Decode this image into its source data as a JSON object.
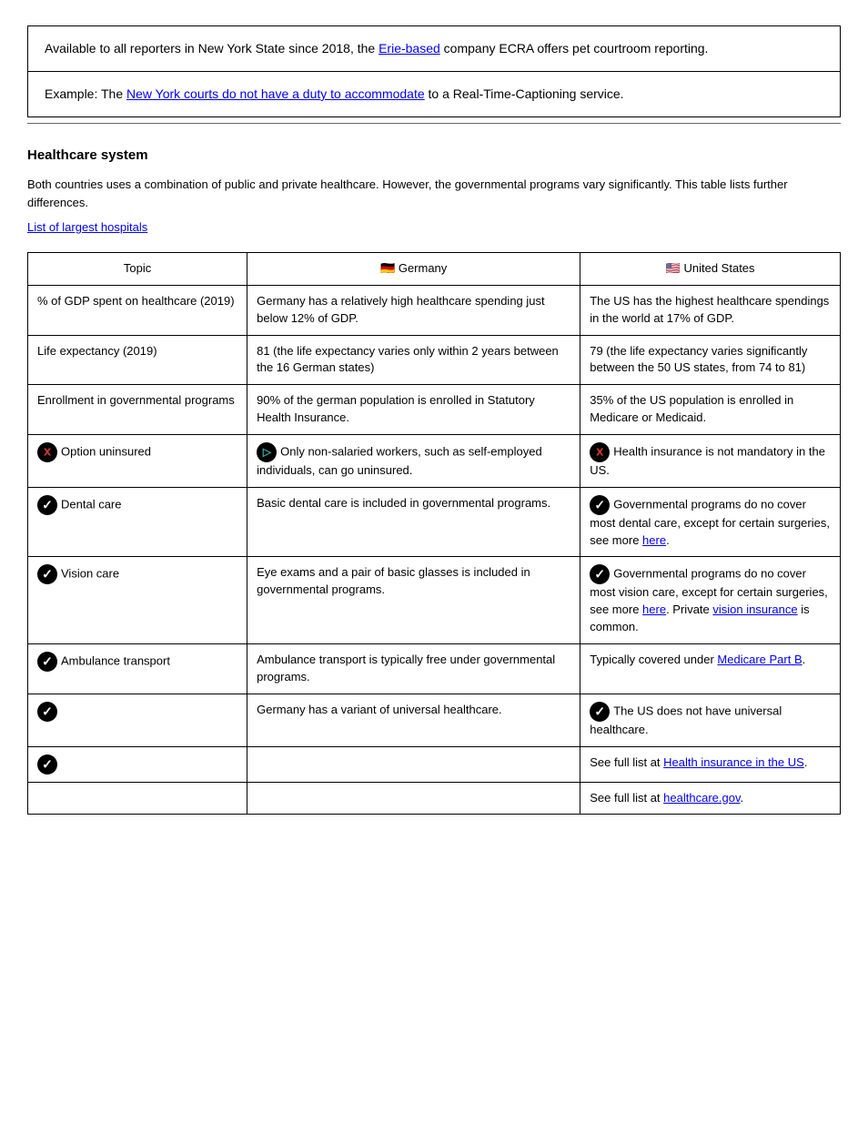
{
  "topbox": {
    "row1_prefix": "Available to all reporters in New York State since 2018, the ",
    "row1_link": "Erie-based",
    "row1_suffix": " company ECRA offers pet courtroom reporting.",
    "row1_link_url": "#",
    "row2_prefix": "Example: The ",
    "row2_link": "New York courts do not have a duty to accommodate",
    "row2_suffix": " to a Real-Time-Captioning service.",
    "row2_link_url": "#"
  },
  "section_title": "Healthcare system",
  "lead_text": "Both countries uses a combination of public and private healthcare. However, the governmental programs vary significantly. This table lists further differences.",
  "list_link_text": "List of largest hospitals",
  "list_link_url": "#",
  "headers": {
    "topic": "Topic",
    "de_flag": "🇩🇪",
    "de": " Germany",
    "us_flag": "🇺🇸",
    "us": " United States"
  },
  "rows": [
    {
      "topic": "% of GDP spent on healthcare (2019)",
      "de": "Germany has a relatively high healthcare spending just below 12% of GDP.",
      "us": "The US has the highest healthcare spendings in the world at 17% of GDP."
    },
    {
      "topic": "Life expectancy (2019)",
      "de": "81 (the life expectancy varies only within 2 years between the 16 German states)",
      "us": "79 (the life expectancy varies significantly between the 50 US states, from 74 to 81)"
    },
    {
      "topic": "Enrollment in governmental programs",
      "de": "90% of the german population is enrolled in Statutory Health Insurance.",
      "us": "35% of the US population is enrolled in Medicare or Medicaid."
    },
    {
      "topic_icon": "no",
      "topic": "Option uninsured",
      "de_icon": "maybe",
      "de": "Only non-salaried workers, such as self-employed individuals, can go uninsured.",
      "us_icon": "no",
      "us": "Health insurance is not mandatory in the US."
    },
    {
      "topic_icon": "yes",
      "topic": "Dental care",
      "de": "Basic dental care is included in governmental programs.",
      "us_icon": "yes",
      "us": "Governmental programs do no cover most dental care, except for certain surgeries, see more ",
      "us_link": "here",
      "us_link_url": "#",
      "us_after": "."
    },
    {
      "topic_icon": "yes",
      "topic": "Vision care",
      "de": "Eye exams and a pair of basic glasses is included in governmental programs.",
      "us_icon": "yes",
      "us": "Governmental programs do no cover most vision care, except for certain surgeries, see more ",
      "us_link": "here",
      "us_link_url": "#",
      "us_after": ". Private ",
      "us_link2": "vision insurance",
      "us_link2_url": "#",
      "us_after2": " is common."
    },
    {
      "topic_icon": "yes",
      "topic": "Ambulance transport",
      "de": "Ambulance transport is typically free under governmental programs.",
      "us": "Typically covered under ",
      "us_link": "Medicare Part B",
      "us_link_url": "#",
      "us_after": "."
    },
    {
      "topic_icon": "yes",
      "topic": "",
      "de": "Germany has a variant of universal healthcare.",
      "us_icon": "yes",
      "us": "The US does not have universal healthcare."
    },
    {
      "topic_icon": "yes",
      "topic": "",
      "de": "",
      "us": "See full list at ",
      "us_link": "Health insurance in the US",
      "us_link_url": "#",
      "us_after": "."
    },
    {
      "topic": "",
      "de": "",
      "us": "See full list at ",
      "us_link": "healthcare.gov",
      "us_link_url": "#",
      "us_after": "."
    }
  ]
}
